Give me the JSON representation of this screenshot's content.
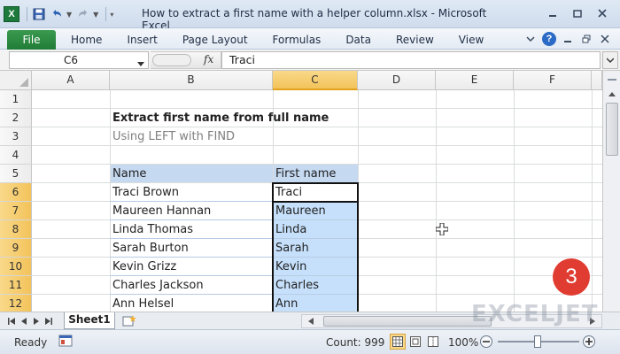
{
  "window": {
    "title": "How to extract a first name with a helper column.xlsx - Microsoft Excel",
    "app_icon_letter": "X"
  },
  "ribbon": {
    "file_tab": "File",
    "tabs": [
      "Home",
      "Insert",
      "Page Layout",
      "Formulas",
      "Data",
      "Review",
      "View"
    ]
  },
  "formula_bar": {
    "name_box": "C6",
    "fx_label": "fx",
    "formula": "Traci"
  },
  "columns": [
    "A",
    "B",
    "C",
    "D",
    "E",
    "F"
  ],
  "active_column": "C",
  "rows": [
    "1",
    "2",
    "3",
    "4",
    "5",
    "6",
    "7",
    "8",
    "9",
    "10",
    "11",
    "12"
  ],
  "active_rows": [
    "6",
    "7",
    "8",
    "9",
    "10",
    "11",
    "12"
  ],
  "sheet": {
    "title": "Extract first name from full name",
    "subtitle": "Using LEFT with FIND",
    "headers": {
      "name": "Name",
      "first_name": "First name"
    },
    "data": [
      {
        "name": "Traci Brown",
        "first": "Traci"
      },
      {
        "name": "Maureen Hannan",
        "first": "Maureen"
      },
      {
        "name": "Linda Thomas",
        "first": "Linda"
      },
      {
        "name": "Sarah Burton",
        "first": "Sarah"
      },
      {
        "name": "Kevin Grizz",
        "first": "Kevin"
      },
      {
        "name": "Charles Jackson",
        "first": "Charles"
      },
      {
        "name": "Ann Helsel",
        "first": "Ann"
      }
    ]
  },
  "badge_number": "3",
  "sheet_tab": "Sheet1",
  "watermark": "EXCELJET",
  "status": {
    "ready": "Ready",
    "count": "Count: 999",
    "zoom": "100%"
  },
  "colors": {
    "header_fill": "#c5d9f1",
    "selection_fill": "#c6e0fb",
    "active_header": "#f6cc6b",
    "badge": "#e03c31",
    "file_tab": "#207c36"
  }
}
